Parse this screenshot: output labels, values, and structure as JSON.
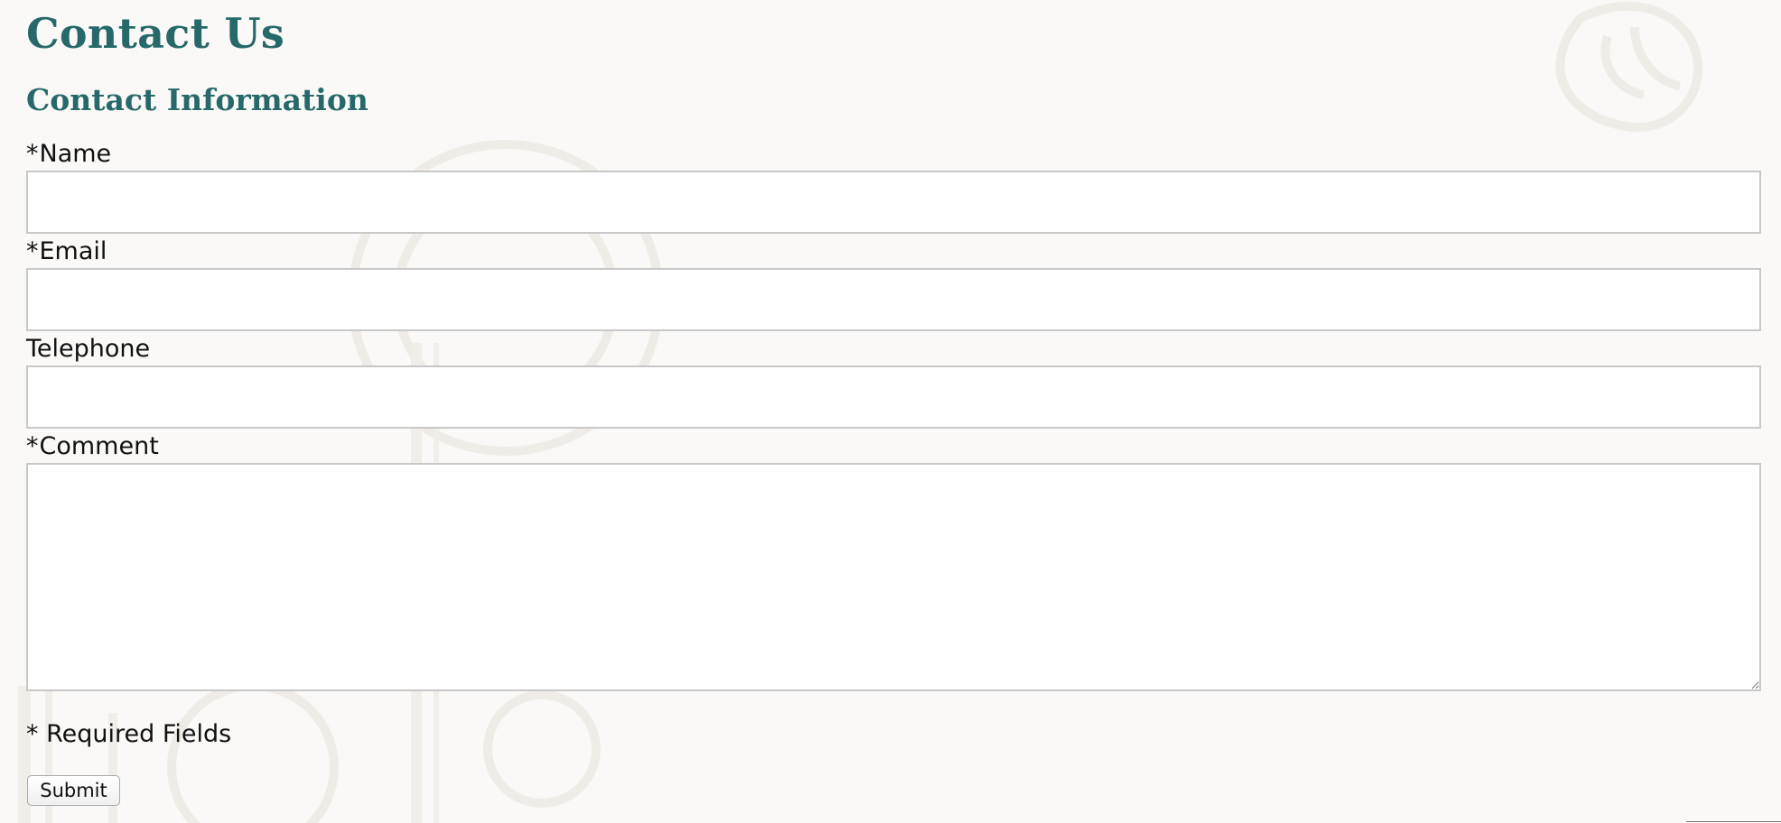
{
  "page": {
    "title": "Contact Us",
    "section_title": "Contact Information"
  },
  "form": {
    "required_marker": "*",
    "fields": [
      {
        "label": "Name",
        "required": true,
        "value": ""
      },
      {
        "label": "Email",
        "required": true,
        "value": ""
      },
      {
        "label": "Telephone",
        "required": false,
        "value": ""
      },
      {
        "label": "Comment",
        "required": true,
        "value": ""
      }
    ],
    "required_note": "* Required Fields",
    "submit_label": "Submit"
  },
  "colors": {
    "heading": "#27696a",
    "background": "#faf9f7",
    "input_border": "#c8c8c8"
  }
}
